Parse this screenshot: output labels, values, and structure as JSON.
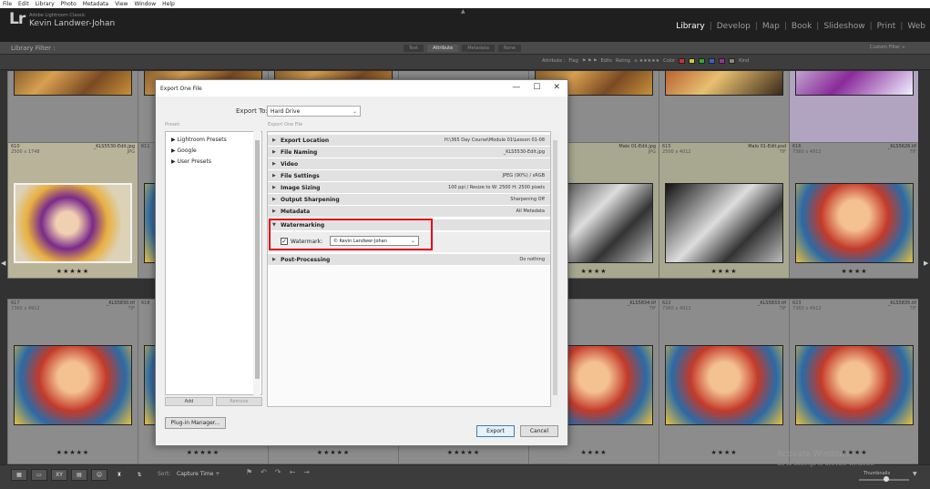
{
  "menubar": [
    "File",
    "Edit",
    "Library",
    "Photo",
    "Metadata",
    "View",
    "Window",
    "Help"
  ],
  "app": {
    "name": "Adobe Lightroom Classic",
    "user": "Kevin Landwer-Johan",
    "logo": "Lr"
  },
  "modules": [
    "Library",
    "Develop",
    "Map",
    "Book",
    "Slideshow",
    "Print",
    "Web"
  ],
  "filter": {
    "title": "Library Filter :",
    "tabs": [
      "Text",
      "Attribute",
      "Metadata",
      "None"
    ],
    "active_tab": "Attribute",
    "custom": "Custom Filter ÷"
  },
  "attribute_bar": {
    "attribute": "Attribute :",
    "flag": "Flag",
    "edits": "Edits",
    "rating": "Rating",
    "color": "Color",
    "kind": "Kind"
  },
  "grid": {
    "row1": [
      {
        "num": "610",
        "fname": "_KLS5530-Edit.jpg",
        "dims": "2500 x 1748",
        "ext": "JPG",
        "stars": "★★★★★"
      },
      {
        "num": "611",
        "fname": "",
        "dims": "",
        "ext": "",
        "stars": ""
      },
      {
        "num": "",
        "fname": "",
        "dims": "",
        "ext": "",
        "stars": ""
      },
      {
        "num": "",
        "fname": "",
        "dims": "",
        "ext": "",
        "stars": ""
      },
      {
        "num": "",
        "fname": "Malo 01-Edit.jpg",
        "dims": "",
        "ext": "JPG",
        "stars": "★★★★"
      },
      {
        "num": "615",
        "fname": "Malo 01-Edit.psd",
        "dims": "2500 x 4012",
        "ext": "TIF",
        "stars": "★★★★"
      },
      {
        "num": "616",
        "fname": "_KLS5626.tif",
        "dims": "7360 x 4912",
        "ext": "TIF",
        "stars": "★★★★"
      }
    ],
    "row2": [
      {
        "num": "617",
        "fname": "_KLS5830.tif",
        "dims": "7360 x 4912",
        "ext": "TIF",
        "stars": "★★★★★"
      },
      {
        "num": "618",
        "fname": "",
        "dims": "",
        "ext": "",
        "stars": ""
      },
      {
        "num": "",
        "fname": "",
        "dims": "",
        "ext": "",
        "stars": ""
      },
      {
        "num": "",
        "fname": "",
        "dims": "",
        "ext": "",
        "stars": ""
      },
      {
        "num": "",
        "fname": "_KLS5834.tif",
        "dims": "",
        "ext": "TIF",
        "stars": "★★★★"
      },
      {
        "num": "622",
        "fname": "_KLS5833.tif",
        "dims": "7360 x 4912",
        "ext": "TIF",
        "stars": "★★★★"
      },
      {
        "num": "623",
        "fname": "_KLS5835.tif",
        "dims": "7360 x 4912",
        "ext": "TIF",
        "stars": "★★★★"
      }
    ],
    "row3_stars": [
      "★★★★★",
      "★★★★★",
      "★★★★★",
      "★★★★★",
      "★★★★",
      "★★★★",
      "★★★★"
    ]
  },
  "dialog": {
    "title": "Export One File",
    "export_to_label": "Export To:",
    "export_to_value": "Hard Drive",
    "preset_label": "Preset:",
    "export_one_label": "Export One File",
    "presets": [
      "Lightroom Presets",
      "Google",
      "User Presets"
    ],
    "add": "Add",
    "remove": "Remove",
    "sections": [
      {
        "title": "Export Location",
        "summary": "H:\\365 Day Course\\Module 01\\Lesson 01-08",
        "open": false
      },
      {
        "title": "File Naming",
        "summary": "_KLS5530-Edit.jpg",
        "open": false
      },
      {
        "title": "Video",
        "summary": "",
        "open": false
      },
      {
        "title": "File Settings",
        "summary": "JPEG (90%) / sRGB",
        "open": false
      },
      {
        "title": "Image Sizing",
        "summary": "100 ppi / Resize to W: 2500 H: 2500 pixels",
        "open": false
      },
      {
        "title": "Output Sharpening",
        "summary": "Sharpening Off",
        "open": false
      },
      {
        "title": "Metadata",
        "summary": "All Metadata",
        "open": false
      },
      {
        "title": "Watermarking",
        "summary": "",
        "open": true
      },
      {
        "title": "Post-Processing",
        "summary": "Do nothing",
        "open": false
      }
    ],
    "watermark_label": "Watermark:",
    "watermark_value": "© Kevin Landwer-Johan",
    "watermark_checked": "✓",
    "plugin_manager": "Plug-in Manager...",
    "export": "Export",
    "cancel": "Cancel",
    "controls": {
      "minimize": "—",
      "maximize": "☐",
      "close": "✕"
    }
  },
  "toolbar": {
    "sort_label": "Sort:",
    "sort_value": "Capture Time ÷",
    "thumbnails": "Thumbnails"
  },
  "os_watermark": {
    "line1": "Activate Windows",
    "line2": "Go to Settings to activate Windows."
  },
  "colors": {
    "highlight": "#e0001a",
    "active_module": "#ffffff"
  }
}
